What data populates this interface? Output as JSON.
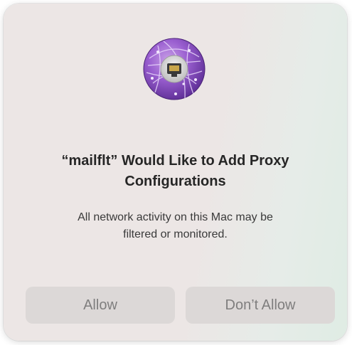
{
  "dialog": {
    "icon": "network-proxy-icon",
    "title_line1": "“mailflt” Would Like to Add Proxy",
    "title_line2": "Configurations",
    "message_line1": "All network activity on this Mac may be",
    "message_line2": "filtered or monitored.",
    "allow_label": "Allow",
    "dont_allow_label": "Don’t Allow"
  },
  "colors": {
    "icon_purple": "#8a4fc4",
    "icon_purple_dark": "#5e2f9a",
    "button_bg": "#dcd8d7",
    "button_text": "#7f7e7e",
    "title_text": "#262626"
  }
}
